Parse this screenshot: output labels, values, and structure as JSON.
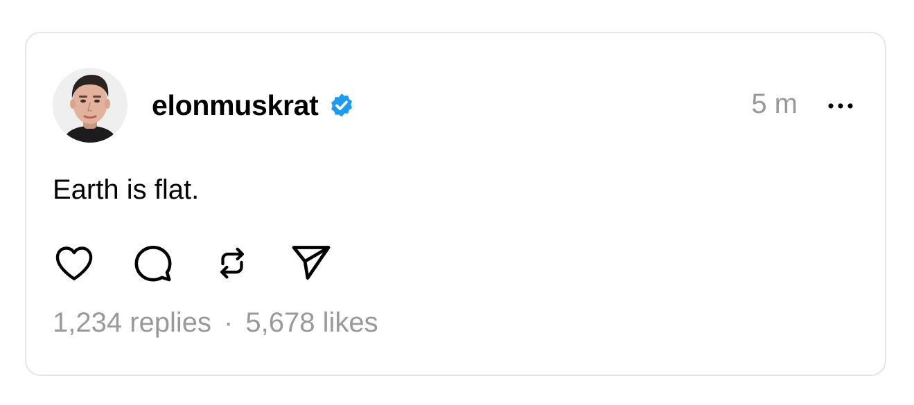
{
  "post": {
    "username": "elonmuskrat",
    "verified": true,
    "time": "5 m",
    "text": "Earth is flat.",
    "replies": "1,234 replies",
    "separator": "·",
    "likes": "5,678 likes"
  },
  "icons": {
    "verified": "verified-badge-icon",
    "more": "more-options-icon",
    "like": "heart-icon",
    "reply": "comment-bubble-icon",
    "repost": "repost-icon",
    "share": "send-icon"
  },
  "colors": {
    "text": "#000000",
    "muted": "#999999",
    "verified": "#1d9bf0",
    "border": "#e6e6e6"
  }
}
